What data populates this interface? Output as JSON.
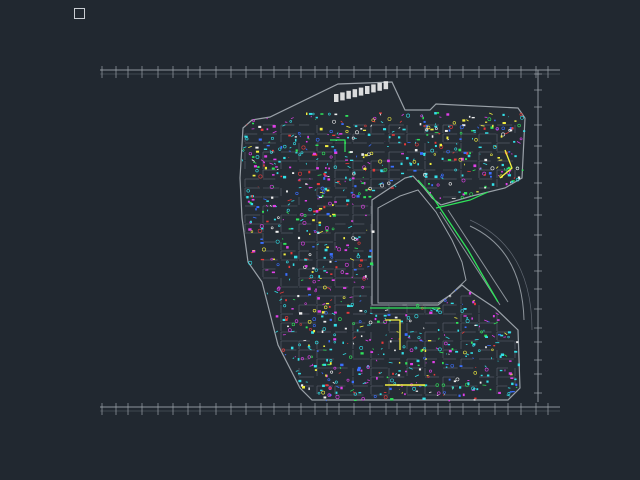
{
  "app": {
    "title": ""
  },
  "canvas": {
    "background": "#212830"
  },
  "palette": {
    "outline": "#9aa1a8",
    "dim": "#6b7178",
    "grid": "#5f6670",
    "magenta": "#e040e8",
    "cyan": "#33e0e8",
    "green": "#2fe25a",
    "yellow": "#f4f040",
    "white": "#f0f0f0",
    "red": "#e83a3a",
    "blue": "#3a6fff"
  },
  "icons": {
    "navigation": "square-outline-icon"
  }
}
